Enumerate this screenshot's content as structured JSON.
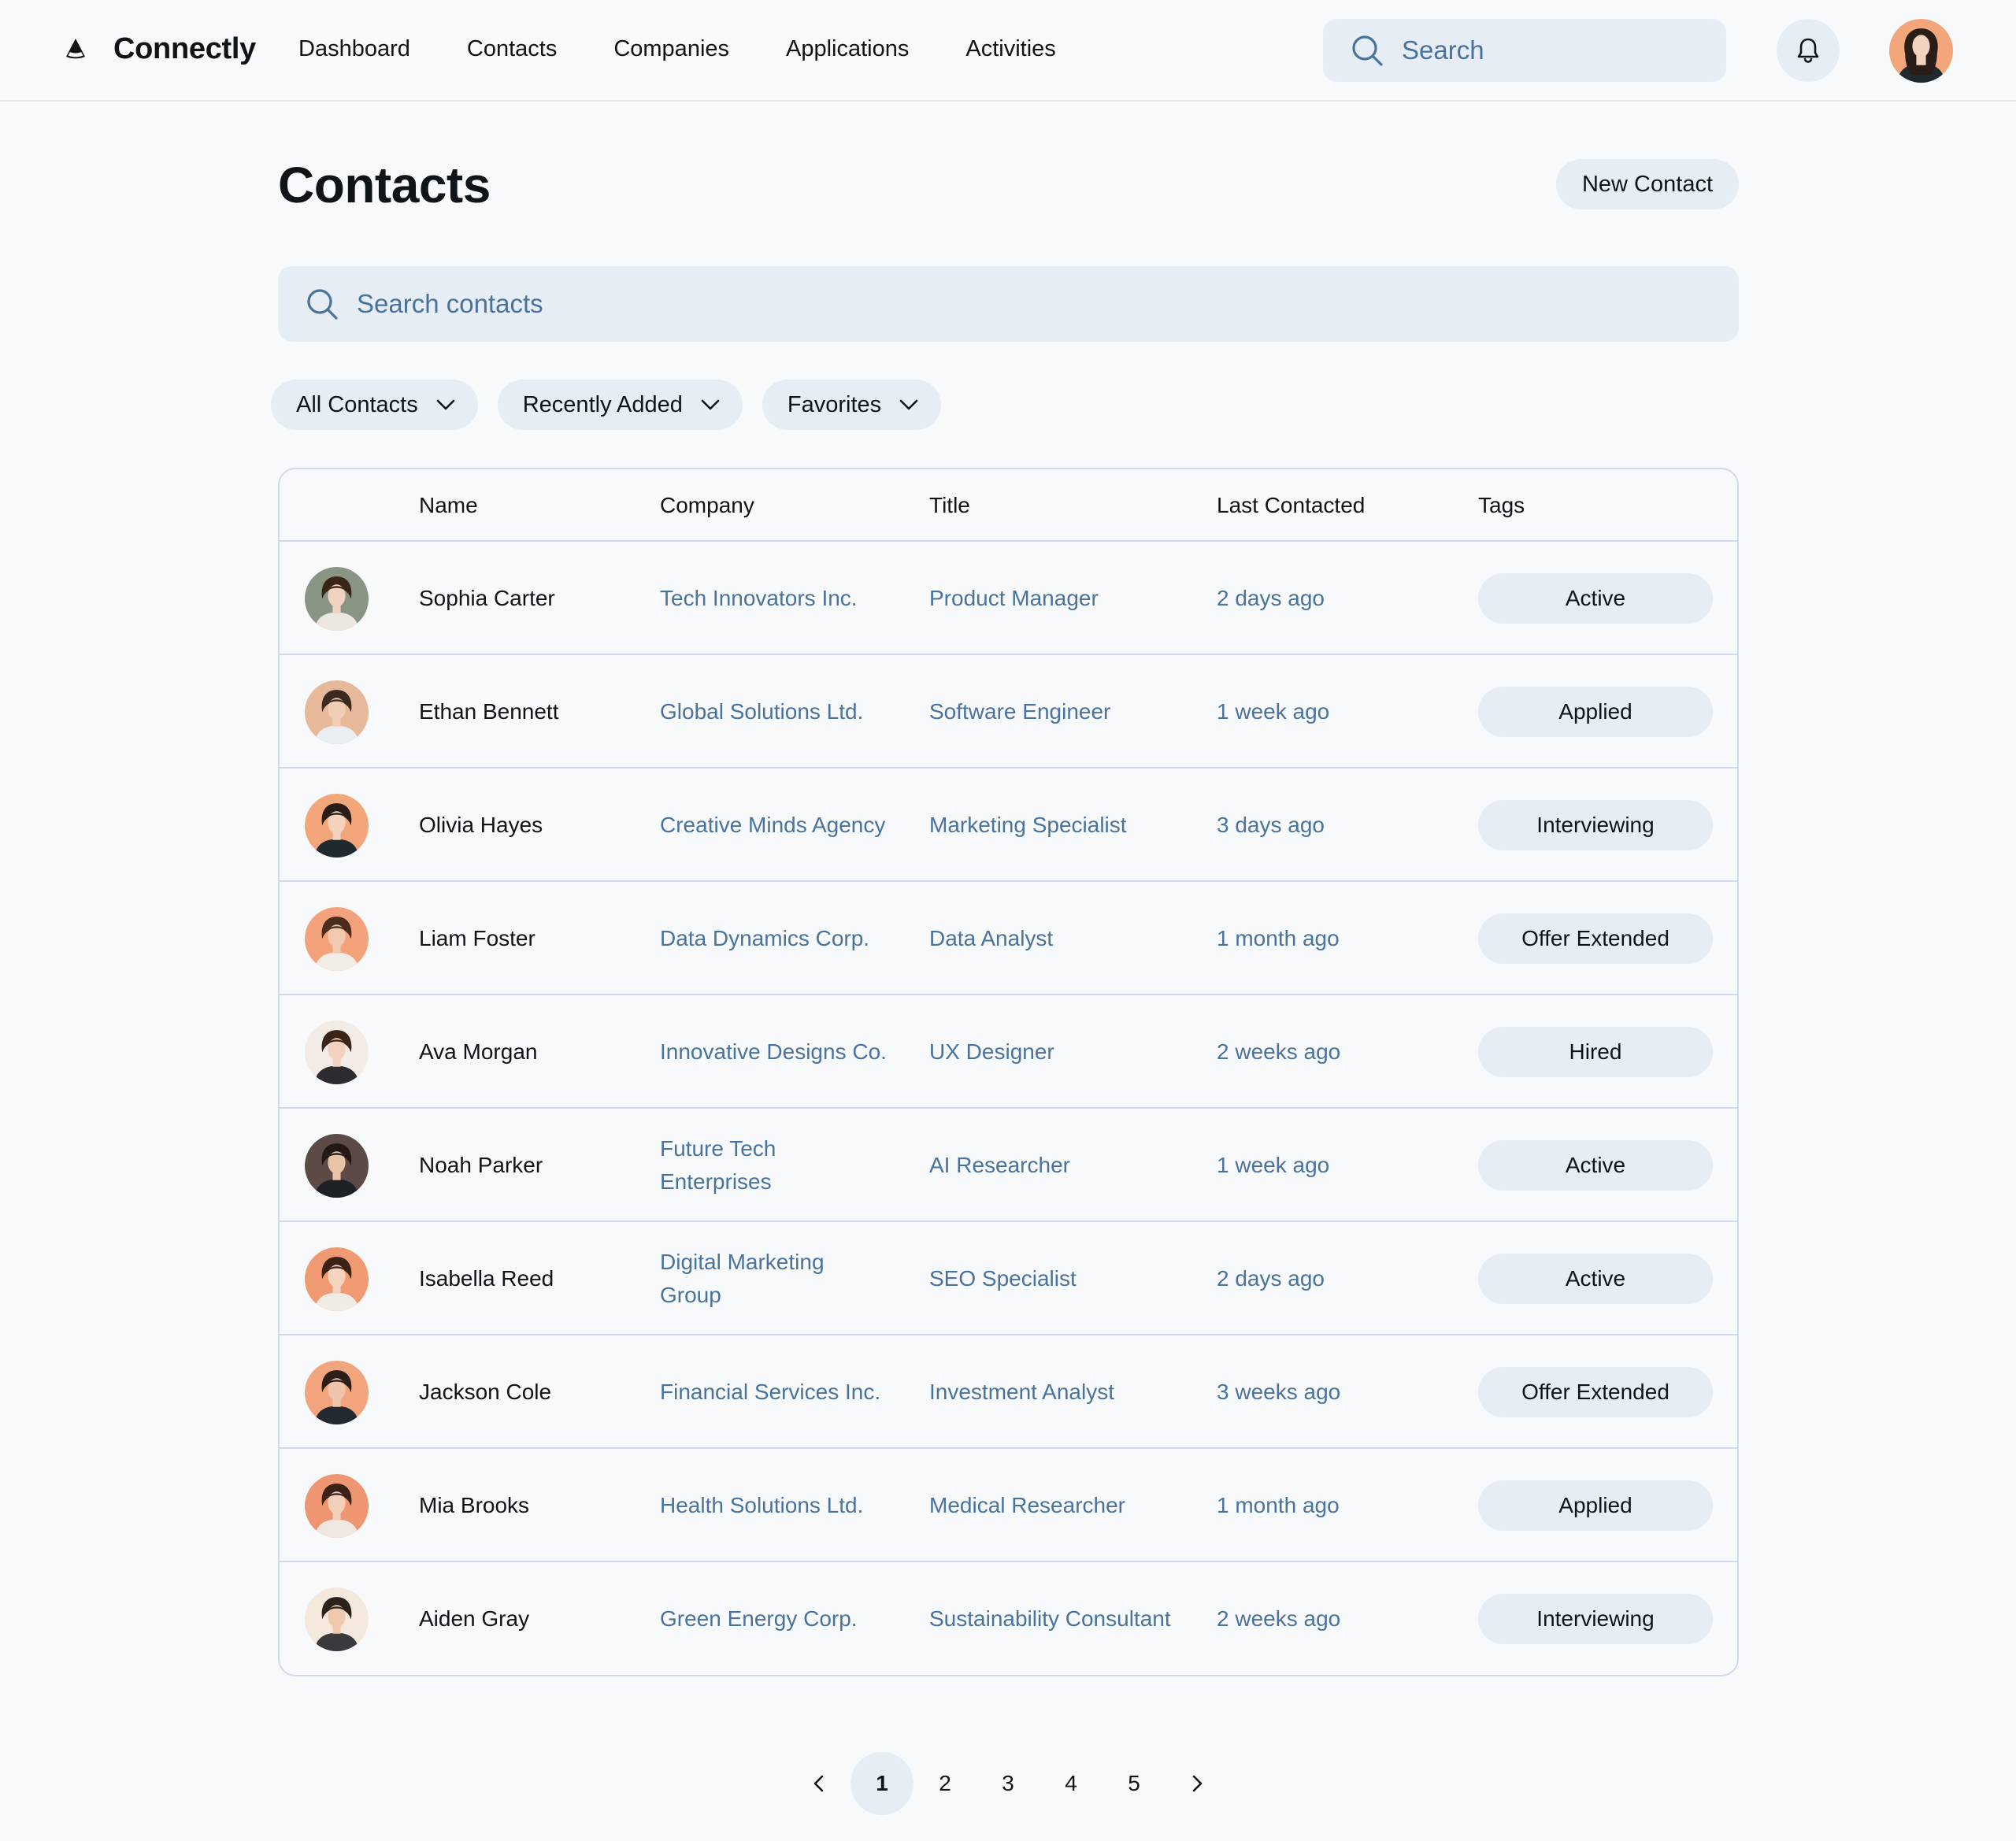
{
  "app": {
    "name": "Connectly"
  },
  "nav": {
    "items": [
      "Dashboard",
      "Contacts",
      "Companies",
      "Applications",
      "Activities"
    ]
  },
  "top_search": {
    "placeholder": "Search"
  },
  "page": {
    "title": "Contacts",
    "new_button": "New Contact"
  },
  "contact_search": {
    "placeholder": "Search contacts"
  },
  "filters": [
    "All Contacts",
    "Recently Added",
    "Favorites"
  ],
  "table": {
    "columns": [
      "Name",
      "Company",
      "Title",
      "Last Contacted",
      "Tags"
    ],
    "rows": [
      {
        "name": "Sophia Carter",
        "company": "Tech Innovators Inc.",
        "title": "Product Manager",
        "last": "2 days ago",
        "tag": "Active",
        "bg": "#8a9485",
        "skin": "#f2d3c0",
        "hair": "#3a2418",
        "shirt": "#ece8e1"
      },
      {
        "name": "Ethan Bennett",
        "company": "Global Solutions Ltd.",
        "title": "Software Engineer",
        "last": "1 week ago",
        "tag": "Applied",
        "bg": "#e8b89a",
        "skin": "#f0cdb5",
        "hair": "#3b2a20",
        "shirt": "#e8eef2"
      },
      {
        "name": "Olivia Hayes",
        "company": "Creative Minds Agency",
        "title": "Marketing Specialist",
        "last": "3 days ago",
        "tag": "Interviewing",
        "bg": "#f2a67a",
        "skin": "#f3d2be",
        "hair": "#2a1c16",
        "shirt": "#1f2a30"
      },
      {
        "name": "Liam Foster",
        "company": "Data Dynamics Corp.",
        "title": "Data Analyst",
        "last": "1 month ago",
        "tag": "Offer Extended",
        "bg": "#f4a27b",
        "skin": "#f0c9ae",
        "hair": "#4a2c1e",
        "shirt": "#f3ede8"
      },
      {
        "name": "Ava Morgan",
        "company": "Innovative Designs Co.",
        "title": "UX Designer",
        "last": "2 weeks ago",
        "tag": "Hired",
        "bg": "#f3ece6",
        "skin": "#f2d2bf",
        "hair": "#3a2419",
        "shirt": "#2b2b30"
      },
      {
        "name": "Noah Parker",
        "company": "Future Tech Enterprises",
        "title": "AI Researcher",
        "last": "1 week ago",
        "tag": "Active",
        "bg": "#5b4a45",
        "skin": "#e9c3a8",
        "hair": "#241815",
        "shirt": "#1e2227"
      },
      {
        "name": "Isabella Reed",
        "company": "Digital Marketing Group",
        "title": "SEO Specialist",
        "last": "2 days ago",
        "tag": "Active",
        "bg": "#ef9a70",
        "skin": "#f4d4bf",
        "hair": "#3b2217",
        "shirt": "#f1ebe6"
      },
      {
        "name": "Jackson Cole",
        "company": "Financial Services Inc.",
        "title": "Investment Analyst",
        "last": "3 weeks ago",
        "tag": "Offer Extended",
        "bg": "#f2a47c",
        "skin": "#eec5aa",
        "hair": "#2b1d17",
        "shirt": "#22292f"
      },
      {
        "name": "Mia Brooks",
        "company": "Health Solutions Ltd.",
        "title": "Medical Researcher",
        "last": "1 month ago",
        "tag": "Applied",
        "bg": "#ee9572",
        "skin": "#f3d0ba",
        "hair": "#3a2218",
        "shirt": "#efe7e1"
      },
      {
        "name": "Aiden Gray",
        "company": "Green Energy Corp.",
        "title": "Sustainability Consultant",
        "last": "2 weeks ago",
        "tag": "Interviewing",
        "bg": "#f4e9dc",
        "skin": "#efc9ad",
        "hair": "#2d211b",
        "shirt": "#3a3a3e"
      }
    ]
  },
  "pagination": {
    "pages": [
      "1",
      "2",
      "3",
      "4",
      "5"
    ],
    "current": "1"
  },
  "colors": {
    "accent_text": "#49739c",
    "chip_bg": "#e7edf4",
    "border": "#d0dbe7",
    "background": "#f7f9fb"
  }
}
